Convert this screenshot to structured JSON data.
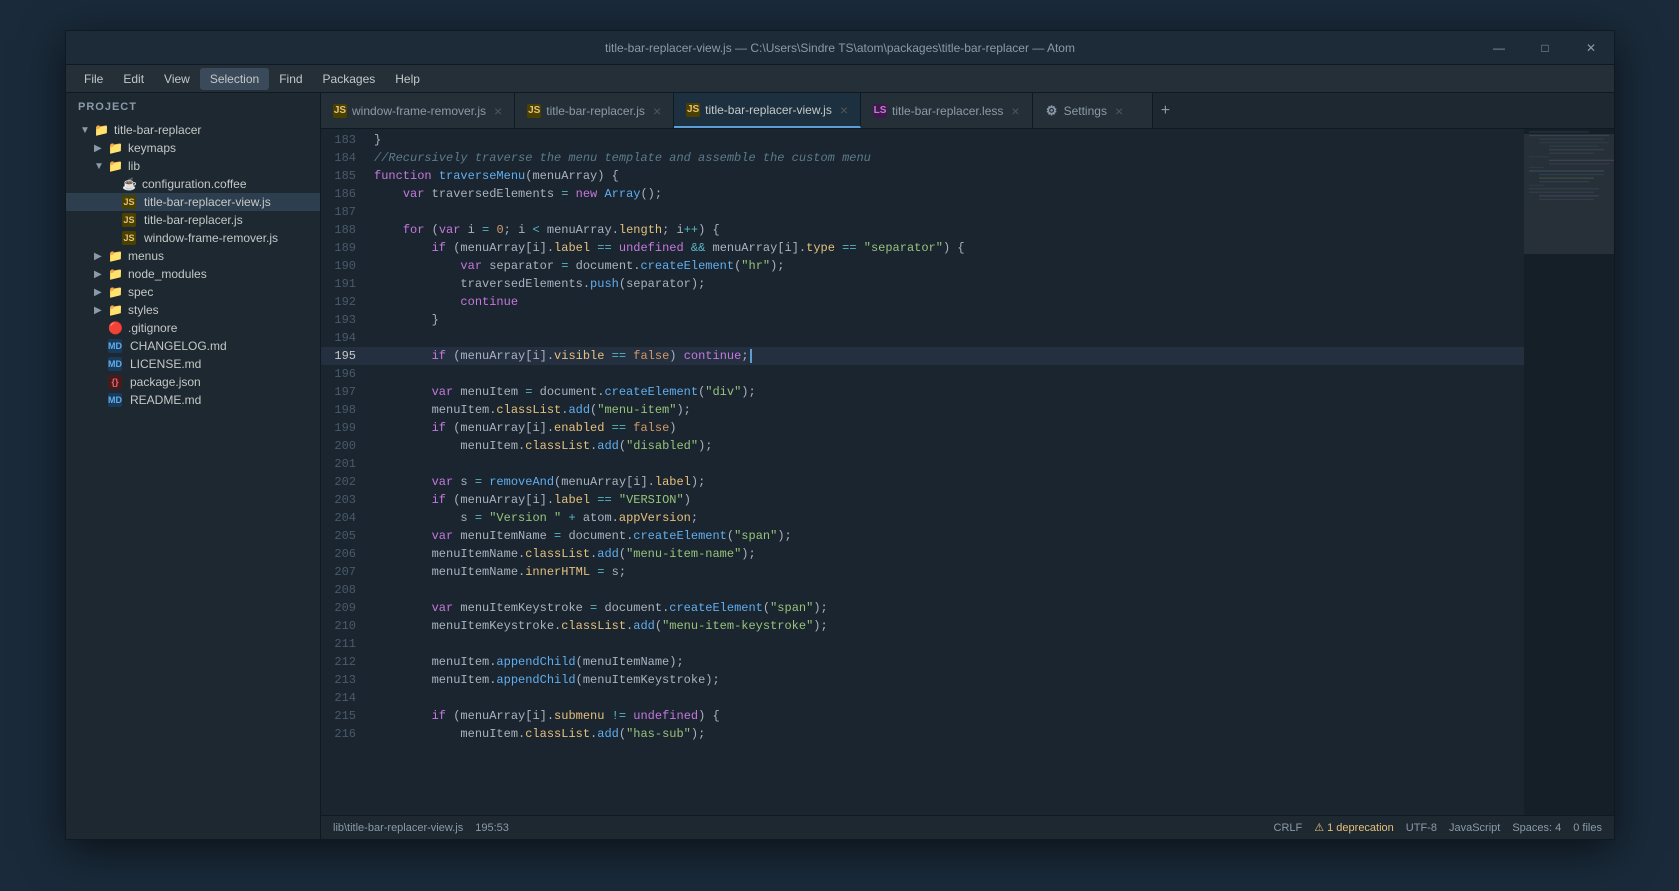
{
  "window": {
    "title": "title-bar-replacer-view.js — C:\\Users\\Sindre TS\\atom\\packages\\title-bar-replacer — Atom",
    "controls": {
      "minimize": "—",
      "maximize": "□",
      "close": "✕"
    }
  },
  "menu": {
    "items": [
      "File",
      "Edit",
      "View",
      "Selection",
      "Find",
      "Packages",
      "Help"
    ]
  },
  "sidebar": {
    "header": "Project",
    "tree": [
      {
        "id": "title-bar-replacer",
        "label": "title-bar-replacer",
        "type": "folder-root",
        "indent": 0,
        "expanded": true
      },
      {
        "id": "keymaps",
        "label": "keymaps",
        "type": "folder",
        "indent": 1,
        "expanded": false
      },
      {
        "id": "lib",
        "label": "lib",
        "type": "folder",
        "indent": 1,
        "expanded": true
      },
      {
        "id": "configuration.coffee",
        "label": "configuration.coffee",
        "type": "coffee",
        "indent": 2
      },
      {
        "id": "title-bar-replacer-view.js",
        "label": "title-bar-replacer-view.js",
        "type": "js",
        "indent": 2,
        "active": true
      },
      {
        "id": "title-bar-replacer.js",
        "label": "title-bar-replacer.js",
        "type": "js",
        "indent": 2
      },
      {
        "id": "window-frame-remover.js",
        "label": "window-frame-remover.js",
        "type": "js",
        "indent": 2
      },
      {
        "id": "menus",
        "label": "menus",
        "type": "folder",
        "indent": 1,
        "expanded": false
      },
      {
        "id": "node_modules",
        "label": "node_modules",
        "type": "folder",
        "indent": 1,
        "expanded": false
      },
      {
        "id": "spec",
        "label": "spec",
        "type": "folder",
        "indent": 1,
        "expanded": false
      },
      {
        "id": "styles",
        "label": "styles",
        "type": "folder",
        "indent": 1,
        "expanded": false
      },
      {
        "id": ".gitignore",
        "label": ".gitignore",
        "type": "git",
        "indent": 1
      },
      {
        "id": "CHANGELOG.md",
        "label": "CHANGELOG.md",
        "type": "md",
        "indent": 1
      },
      {
        "id": "LICENSE.md",
        "label": "LICENSE.md",
        "type": "md",
        "indent": 1
      },
      {
        "id": "package.json",
        "label": "package.json",
        "type": "json",
        "indent": 1
      },
      {
        "id": "README.md",
        "label": "README.md",
        "type": "md",
        "indent": 1
      }
    ]
  },
  "tabs": [
    {
      "id": "window-frame-remover",
      "label": "window-frame-remover.js",
      "type": "js",
      "active": false
    },
    {
      "id": "title-bar-replacer",
      "label": "title-bar-replacer.js",
      "type": "js",
      "active": false
    },
    {
      "id": "title-bar-replacer-view",
      "label": "title-bar-replacer-view.js",
      "type": "js",
      "active": true
    },
    {
      "id": "title-bar-replacer-less",
      "label": "title-bar-replacer.less",
      "type": "less",
      "active": false
    },
    {
      "id": "settings",
      "label": "Settings",
      "type": "settings",
      "active": false
    }
  ],
  "code": {
    "lines": [
      {
        "num": 183,
        "content": "}"
      },
      {
        "num": 184,
        "content": "//Recursively traverse the menu template and assemble the custom menu"
      },
      {
        "num": 185,
        "content": "function traverseMenu(menuArray) {"
      },
      {
        "num": 186,
        "content": "    var traversedElements = new Array();"
      },
      {
        "num": 187,
        "content": ""
      },
      {
        "num": 188,
        "content": "    for (var i = 0; i < menuArray.length; i++) {"
      },
      {
        "num": 189,
        "content": "        if (menuArray[i].label == undefined && menuArray[i].type == \"separator\") {"
      },
      {
        "num": 190,
        "content": "            var separator = document.createElement(\"hr\");"
      },
      {
        "num": 191,
        "content": "            traversedElements.push(separator);"
      },
      {
        "num": 192,
        "content": "            continue"
      },
      {
        "num": 193,
        "content": "        }"
      },
      {
        "num": 194,
        "content": ""
      },
      {
        "num": 195,
        "content": "        if (menuArray[i].visible == false) continue;"
      },
      {
        "num": 196,
        "content": ""
      },
      {
        "num": 197,
        "content": "        var menuItem = document.createElement(\"div\");"
      },
      {
        "num": 198,
        "content": "        menuItem.classList.add(\"menu-item\");"
      },
      {
        "num": 199,
        "content": "        if (menuArray[i].enabled == false)"
      },
      {
        "num": 200,
        "content": "            menuItem.classList.add(\"disabled\");"
      },
      {
        "num": 201,
        "content": ""
      },
      {
        "num": 202,
        "content": "        var s = removeAnd(menuArray[i].label);"
      },
      {
        "num": 203,
        "content": "        if (menuArray[i].label == \"VERSION\")"
      },
      {
        "num": 204,
        "content": "            s = \"Version \" + atom.appVersion;"
      },
      {
        "num": 205,
        "content": "        var menuItemName = document.createElement(\"span\");"
      },
      {
        "num": 206,
        "content": "        menuItemName.classList.add(\"menu-item-name\");"
      },
      {
        "num": 207,
        "content": "        menuItemName.innerHTML = s;"
      },
      {
        "num": 208,
        "content": ""
      },
      {
        "num": 209,
        "content": "        var menuItemKeystroke = document.createElement(\"span\");"
      },
      {
        "num": 210,
        "content": "        menuItemKeystroke.classList.add(\"menu-item-keystroke\");"
      },
      {
        "num": 211,
        "content": ""
      },
      {
        "num": 212,
        "content": "        menuItem.appendChild(menuItemName);"
      },
      {
        "num": 213,
        "content": "        menuItem.appendChild(menuItemKeystroke);"
      },
      {
        "num": 214,
        "content": ""
      },
      {
        "num": 215,
        "content": "        if (menuArray[i].submenu != undefined) {"
      },
      {
        "num": 216,
        "content": "            menuItem.classList.add(\"has-sub\");"
      }
    ],
    "active_line": 195
  },
  "status": {
    "left": {
      "file_path": "lib\\title-bar-replacer-view.js",
      "position": "195:53"
    },
    "right": {
      "line_ending": "CRLF",
      "warning": "1 deprecation",
      "encoding": "UTF-8",
      "language": "JavaScript",
      "indent": "Spaces: 4",
      "files": "0 files"
    }
  },
  "add_tab_label": "+",
  "tab_close": "×"
}
